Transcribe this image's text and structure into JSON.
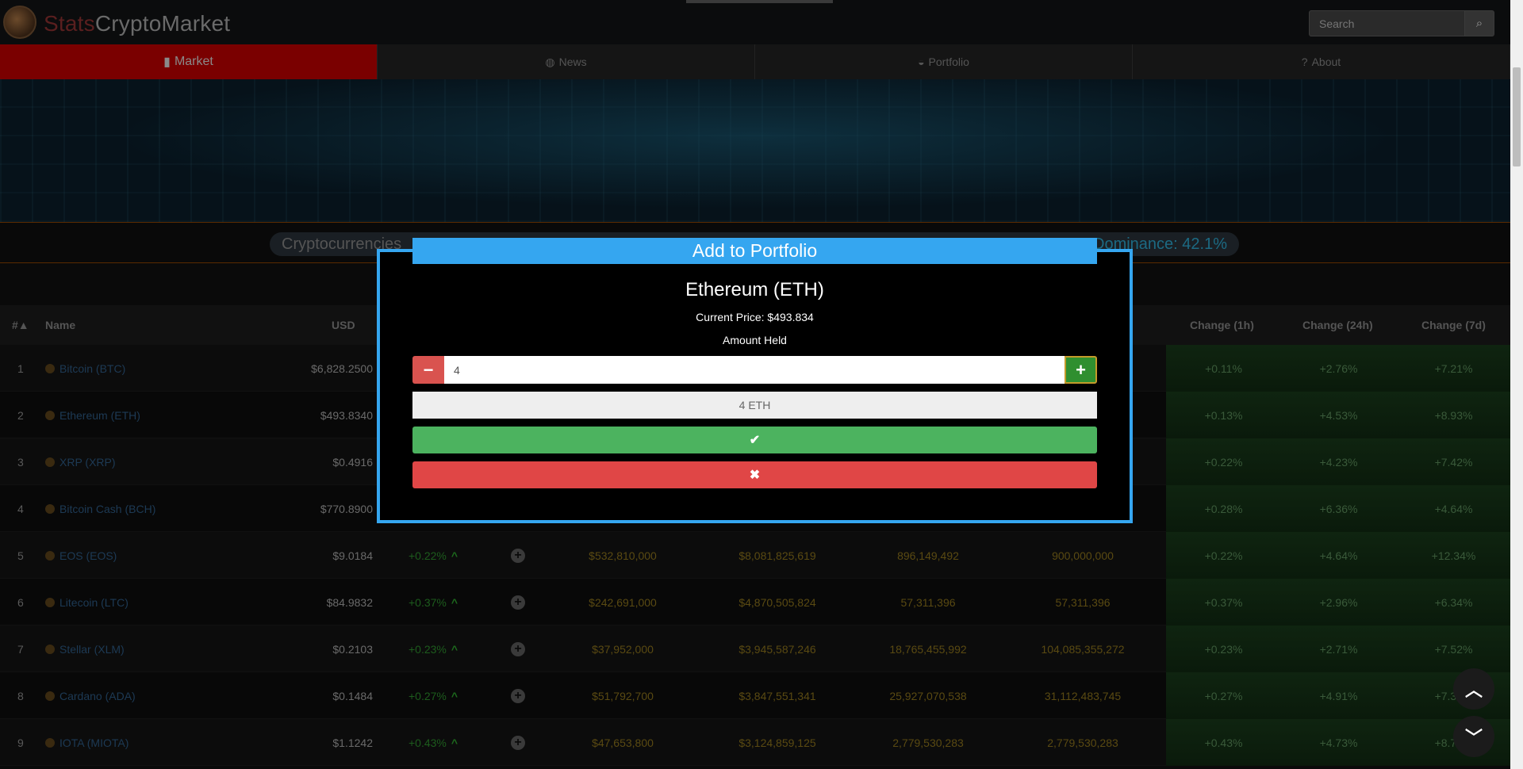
{
  "header": {
    "logo_prefix": "Stats",
    "logo_suffix": "CryptoMarket",
    "search_placeholder": "Search",
    "search_icon": "search-icon"
  },
  "nav": [
    {
      "label": "Market",
      "icon": "bar-chart-icon",
      "glyph": "▮"
    },
    {
      "label": "News",
      "icon": "globe-icon",
      "glyph": "◍"
    },
    {
      "label": "Portfolio",
      "icon": "piggy-bank-icon",
      "glyph": "◒"
    },
    {
      "label": "About",
      "icon": "question-circle-icon",
      "glyph": "?"
    }
  ],
  "stats_bar": {
    "prefix": "Cryptocurrencies",
    "dominance_label": "Dominance:",
    "dominance_value": "42.1%"
  },
  "table": {
    "headers": {
      "num": "#▲",
      "name": "Name",
      "usd": "USD",
      "change_1h": "Change (1h)",
      "change_24h": "Change (24h)",
      "change_7d": "Change (7d)"
    },
    "rows": [
      {
        "num": "1",
        "name": "Bitcoin (BTC)",
        "usd": "$6,828.2500",
        "chg": "",
        "vol": "",
        "mcap": "",
        "circ": "",
        "total": "",
        "h1": "+0.11%",
        "h24": "+2.76%",
        "d7": "+7.21%"
      },
      {
        "num": "2",
        "name": "Ethereum (ETH)",
        "usd": "$493.8340",
        "chg": "",
        "vol": "",
        "mcap": "",
        "circ": "",
        "total": "",
        "h1": "+0.13%",
        "h24": "+4.53%",
        "d7": "+8.93%"
      },
      {
        "num": "3",
        "name": "XRP (XRP)",
        "usd": "$0.4916",
        "chg": "",
        "vol": "",
        "mcap": "",
        "circ": "",
        "total": "",
        "h1": "+0.22%",
        "h24": "+4.23%",
        "d7": "+7.42%"
      },
      {
        "num": "4",
        "name": "Bitcoin Cash (BCH)",
        "usd": "$770.8900",
        "chg": "",
        "vol": "",
        "mcap": "",
        "circ": "",
        "total": "",
        "h1": "+0.28%",
        "h24": "+6.36%",
        "d7": "+4.64%"
      },
      {
        "num": "5",
        "name": "EOS (EOS)",
        "usd": "$9.0184",
        "chg": "+0.22%",
        "vol": "$532,810,000",
        "mcap": "$8,081,825,619",
        "circ": "896,149,492",
        "total": "900,000,000",
        "h1": "+0.22%",
        "h24": "+4.64%",
        "d7": "+12.34%"
      },
      {
        "num": "6",
        "name": "Litecoin (LTC)",
        "usd": "$84.9832",
        "chg": "+0.37%",
        "vol": "$242,691,000",
        "mcap": "$4,870,505,824",
        "circ": "57,311,396",
        "total": "57,311,396",
        "h1": "+0.37%",
        "h24": "+2.96%",
        "d7": "+6.34%"
      },
      {
        "num": "7",
        "name": "Stellar (XLM)",
        "usd": "$0.2103",
        "chg": "+0.23%",
        "vol": "$37,952,000",
        "mcap": "$3,945,587,246",
        "circ": "18,765,455,992",
        "total": "104,085,355,272",
        "h1": "+0.23%",
        "h24": "+2.71%",
        "d7": "+7.52%"
      },
      {
        "num": "8",
        "name": "Cardano (ADA)",
        "usd": "$0.1484",
        "chg": "+0.27%",
        "vol": "$51,792,700",
        "mcap": "$3,847,551,341",
        "circ": "25,927,070,538",
        "total": "31,112,483,745",
        "h1": "+0.27%",
        "h24": "+4.91%",
        "d7": "+7.37%"
      },
      {
        "num": "9",
        "name": "IOTA (MIOTA)",
        "usd": "$1.1242",
        "chg": "+0.43%",
        "vol": "$47,653,800",
        "mcap": "$3,124,859,125",
        "circ": "2,779,530,283",
        "total": "2,779,530,283",
        "h1": "+0.43%",
        "h24": "+4.73%",
        "d7": "+8.74%"
      }
    ]
  },
  "modal": {
    "title": "Add to Portfolio",
    "coin": "Ethereum (ETH)",
    "price_text": "Current Price: $493.834",
    "amount_label": "Amount Held",
    "amount_value": "4",
    "amount_display": "4 ETH",
    "confirm_icon": "check-icon",
    "cancel_icon": "close-icon"
  },
  "colors": {
    "accent": "#35a6f0",
    "confirm": "#4cb35f",
    "cancel": "#e04646",
    "nav_active": "#7a0000"
  }
}
